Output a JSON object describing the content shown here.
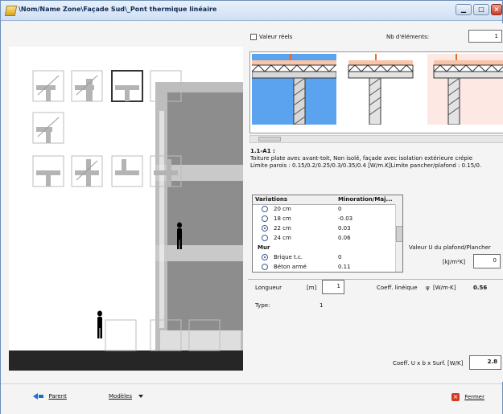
{
  "window": {
    "title": "\\Nom/Name Zone\\Façade Sud\\_Pont thermique linéaire"
  },
  "top_options": {
    "real_values_label": "Valeur réels",
    "nb_elements_label": "Nb d'éléments:",
    "nb_elements_value": "1"
  },
  "selection": {
    "code": "1.1-A1 :",
    "description": "Toiture plate avec avant-toit, Non isolé, façade avec isolation extérieure crépie",
    "limits": "Limite parois : 0.15/0.2/0.25/0.3/0.35/0.4 [W/m.K]Limite pancher/plafond : 0.15/0."
  },
  "variations": {
    "headers": [
      "Variations",
      "Minoration/Maj..."
    ],
    "rows": [
      {
        "label": "20 cm",
        "value": "0",
        "selected": false
      },
      {
        "label": "18 cm",
        "value": "-0.03",
        "selected": false
      },
      {
        "label": "22 cm",
        "value": "0.03",
        "selected": true
      },
      {
        "label": "24 cm",
        "value": "0.06",
        "selected": false
      },
      {
        "group": "Mur"
      },
      {
        "label": "Brique t.c.",
        "value": "0",
        "selected": true
      },
      {
        "label": "Béton armé",
        "value": "0.11",
        "selected": false
      }
    ]
  },
  "u_value": {
    "label": "Valeur U du plafond/Plancher",
    "unit": "[kJ/m²K]",
    "value": "0"
  },
  "length": {
    "label": "Longueur",
    "unit": "[m]",
    "value": "1"
  },
  "linear_coeff": {
    "label": "Coeff. linéique",
    "symbol": "ψ",
    "unit": "[W/m·K]",
    "value": "0.56"
  },
  "type": {
    "label": "Type:",
    "value": "1"
  },
  "coeff_total": {
    "label": "Coeff. U x b x Surf.",
    "unit": "[W/K]",
    "value": "2.8"
  },
  "footer": {
    "parent_label": "Parent",
    "models_label": "Modèles",
    "close_label": "Fermer"
  },
  "colors": {
    "selected_thumb": "#5ba3ee",
    "wall_gray": "#8d8d8d",
    "ground": "#262626"
  }
}
